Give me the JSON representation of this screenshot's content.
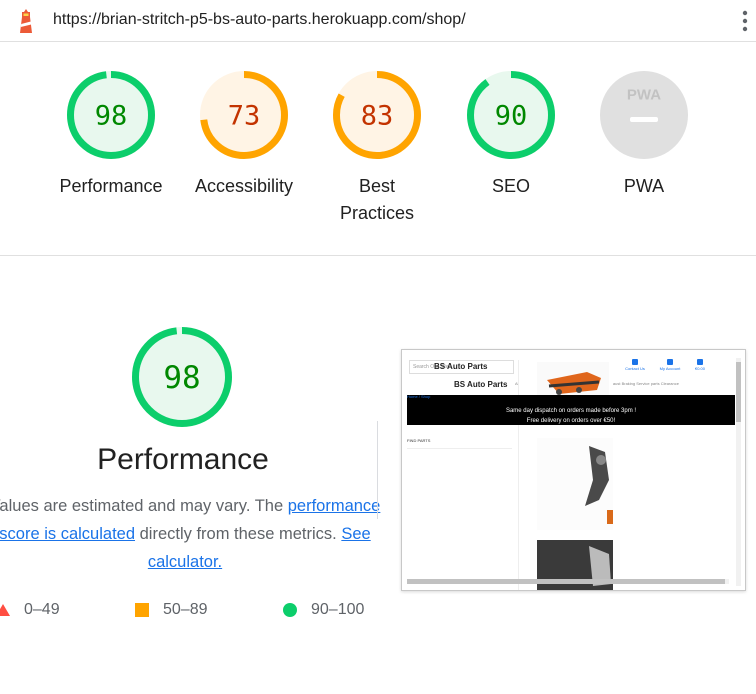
{
  "browser": {
    "url": "https://brian-stritch-p5-bs-auto-parts.herokuapp.com/shop/"
  },
  "colors": {
    "pass": "#0cce6b",
    "pass_text": "#008800",
    "pass_bg": "#e8f8ee",
    "average": "#ffa400",
    "average_text": "#c33300",
    "average_bg": "#fff4e5",
    "fail": "#ff4e42",
    "na": "#e0e0e0",
    "link": "#1a73e8"
  },
  "gauges": [
    {
      "label": "Performance",
      "score": "98",
      "value": 98,
      "rating": "pass"
    },
    {
      "label": "Accessibility",
      "score": "73",
      "value": 73,
      "rating": "average"
    },
    {
      "label": "Best Practices",
      "score": "83",
      "value": 83,
      "rating": "average"
    },
    {
      "label": "SEO",
      "score": "90",
      "value": 90,
      "rating": "pass"
    },
    {
      "label": "PWA",
      "badge": "PWA",
      "rating": "na"
    }
  ],
  "performance": {
    "score": "98",
    "value": 98,
    "title": "Performance",
    "desc_text1": "Values are estimated and may vary. The",
    "desc_link1": "performance score is calculated",
    "desc_text2": "directly from these metrics.",
    "desc_link2": "See calculator."
  },
  "legend": [
    {
      "shape": "triangle-icon",
      "range": "0–49"
    },
    {
      "shape": "square-icon",
      "range": "50–89"
    },
    {
      "shape": "circle-icon",
      "range": "90–100"
    }
  ],
  "screenshot": {
    "search_placeholder": "Search Our Site",
    "brand": "BS Auto Parts",
    "nav_left": "All Products",
    "nav_right": "Exhaust  Braking  Service parts  Clearance",
    "contact": "Contact Us",
    "account": "My Account",
    "cart": "€0.00",
    "breadcrumb": "Home / Shop",
    "banner_line1": "Same day dispatch on orders made before 3pm !",
    "banner_line2": "Free delivery on orders over €50!",
    "sidebar_heading": "FIND PARTS"
  }
}
